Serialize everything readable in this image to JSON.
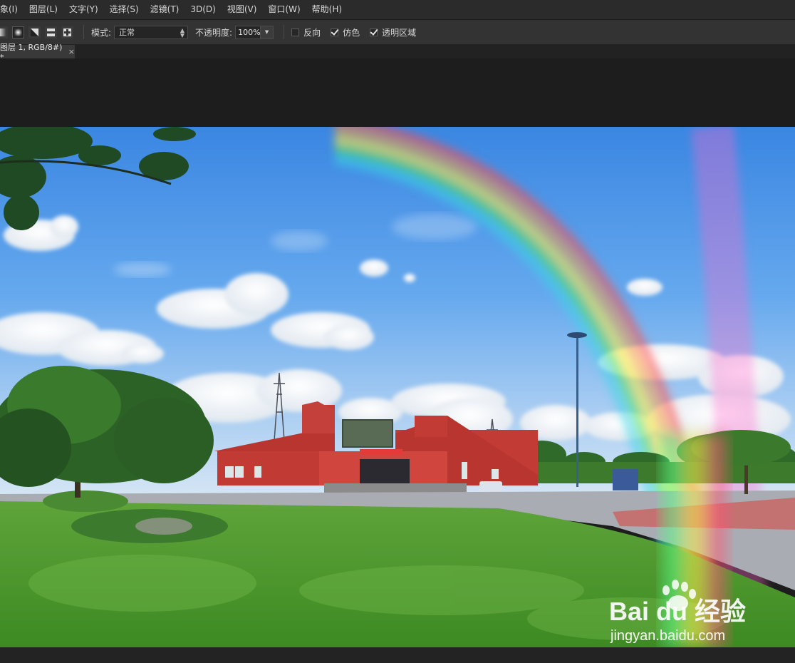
{
  "menubar": {
    "items": [
      "象(I)",
      "图层(L)",
      "文字(Y)",
      "选择(S)",
      "滤镜(T)",
      "3D(D)",
      "视图(V)",
      "窗口(W)",
      "帮助(H)"
    ]
  },
  "options": {
    "mode_label": "模式:",
    "mode_value": "正常",
    "opacity_label": "不透明度:",
    "opacity_value": "100%",
    "reverse_label": "反向",
    "reverse_checked": false,
    "dither_label": "仿色",
    "dither_checked": true,
    "transparency_label": "透明区域",
    "transparency_checked": true,
    "gradient_types": [
      "linear-gradient-icon",
      "radial-gradient-icon",
      "angle-gradient-icon",
      "reflected-gradient-icon",
      "diamond-gradient-icon"
    ],
    "active_gradient": 1
  },
  "document": {
    "tab_title": "图层 1, RGB/8#) *",
    "close_glyph": "×"
  },
  "watermark": {
    "brand": "Bai du 经验",
    "url": "jingyan.baidu.com"
  },
  "colors": {
    "app_bg": "#1b1b1b",
    "menubar": "#2b2b2b",
    "options_bar": "#333333",
    "sky_top": "#3f8ee6",
    "grass": "#4f9a2c"
  }
}
